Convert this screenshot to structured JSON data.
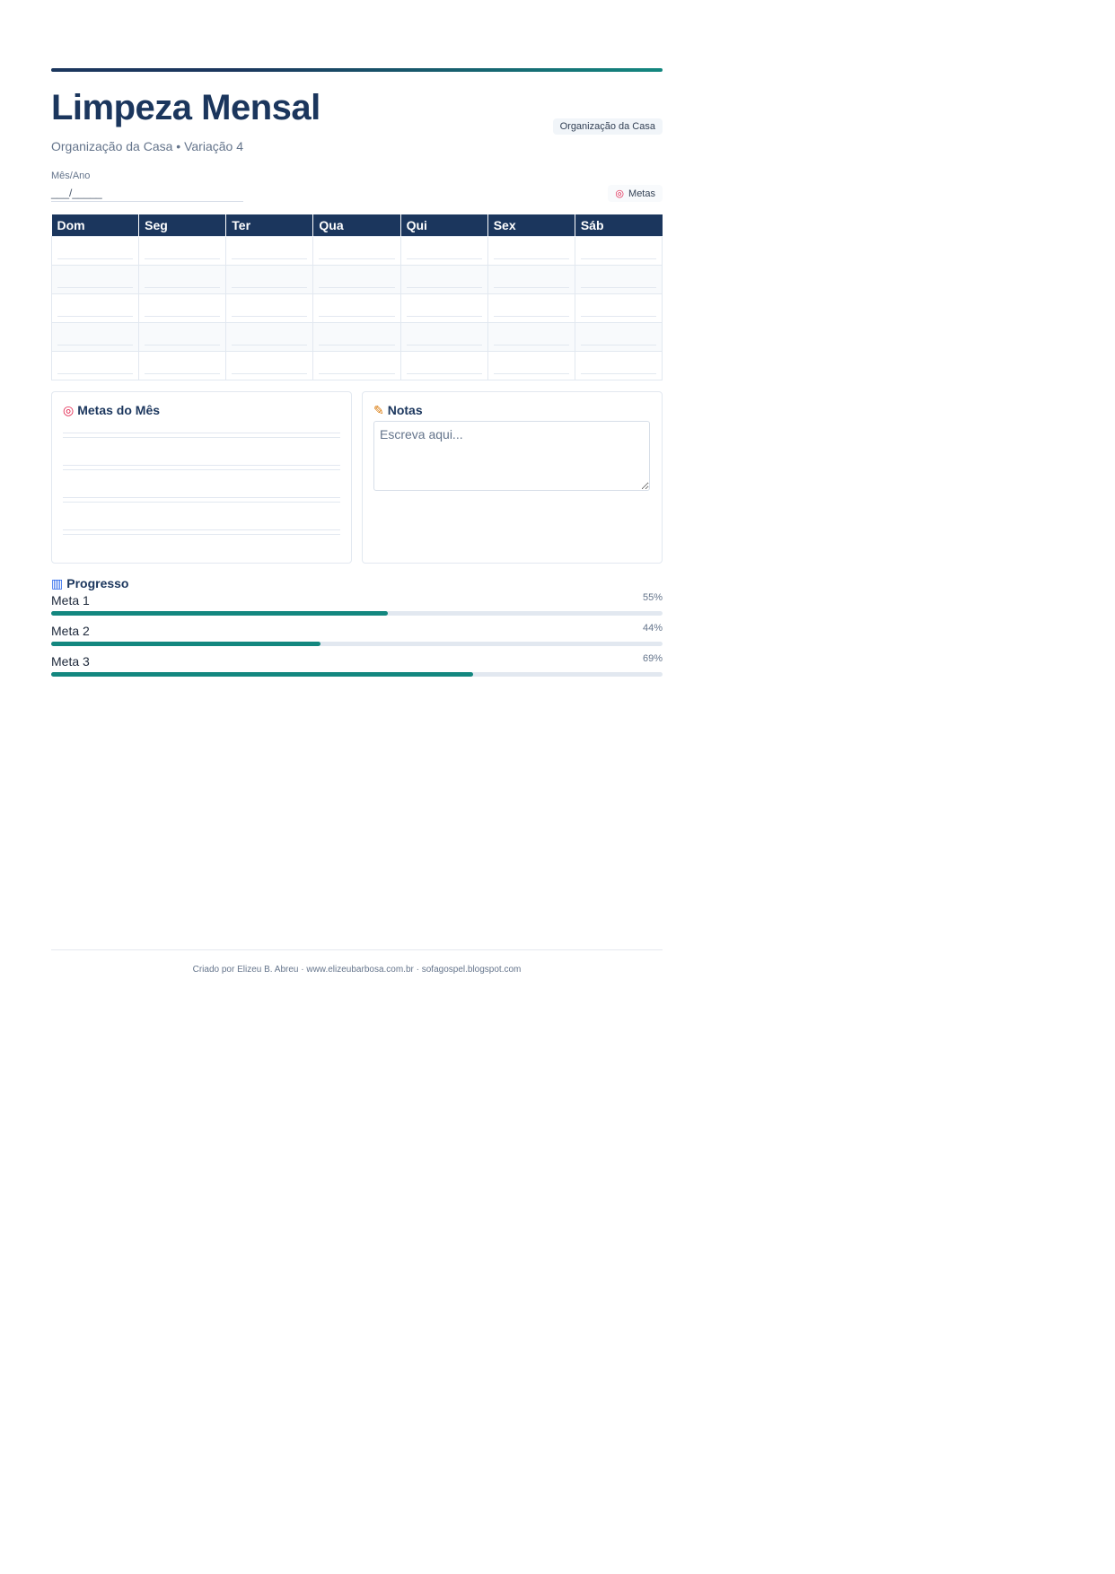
{
  "header": {
    "title": "Limpeza Mensal",
    "subtitle": "Organização da Casa • Variação 4",
    "badge": "Organização da Casa",
    "month_label": "Mês/Ano",
    "month_value": "___/_____",
    "goals_chip_icon": "target-icon",
    "goals_chip_label": "Metas"
  },
  "calendar": {
    "days": [
      "Dom",
      "Seg",
      "Ter",
      "Qua",
      "Qui",
      "Sex",
      "Sáb"
    ],
    "weeks": 5
  },
  "goals_panel": {
    "icon": "target-icon",
    "title": "Metas do Mês",
    "lines": 4
  },
  "notes_panel": {
    "icon": "memo-icon",
    "title": "Notas",
    "placeholder": "Escreva aqui..."
  },
  "progress": {
    "icon": "bar-chart-icon",
    "title": "Progresso",
    "items": [
      {
        "label": "Meta 1",
        "percent_text": "55%",
        "value": 55
      },
      {
        "label": "Meta 2",
        "percent_text": "44%",
        "value": 44
      },
      {
        "label": "Meta 3",
        "percent_text": "69%",
        "value": 69
      }
    ]
  },
  "footer": {
    "text": "Criado por Elizeu B. Abreu · www.elizeubarbosa.com.br · sofagospel.blogspot.com"
  },
  "colors": {
    "primary": "#1b365d",
    "accent": "#13877f",
    "track": "#e2e8f0"
  }
}
